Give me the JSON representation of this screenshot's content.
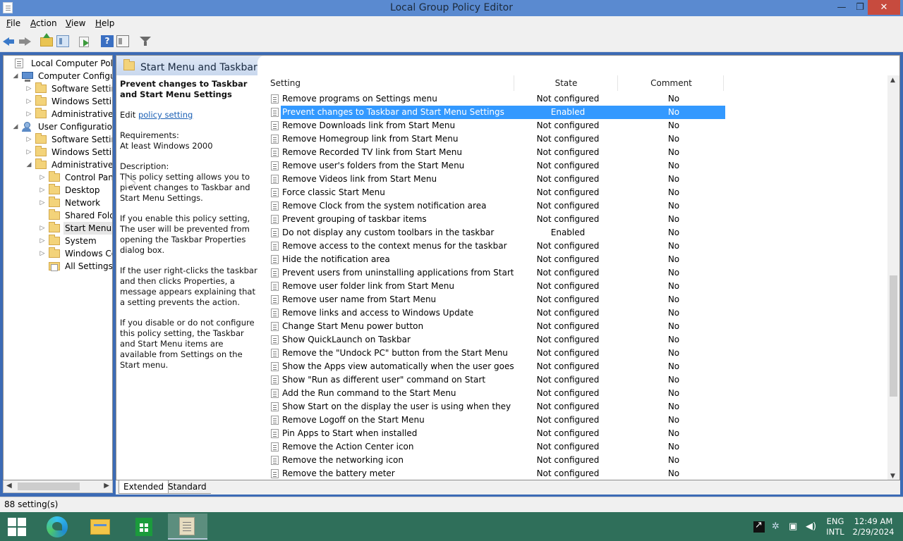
{
  "window": {
    "title": "Local Group Policy Editor",
    "controls": {
      "minimize": "—",
      "maximize": "❐",
      "close": "✕"
    }
  },
  "menubar": [
    {
      "label": "File",
      "accel": "F"
    },
    {
      "label": "Action",
      "accel": "A"
    },
    {
      "label": "View",
      "accel": "V"
    },
    {
      "label": "Help",
      "accel": "H"
    }
  ],
  "toolbar": {
    "icons": [
      "back-icon",
      "forward-icon",
      "up-folder-icon",
      "show-hide-tree-icon",
      "export-list-icon",
      "help-icon",
      "properties-icon",
      "filter-icon"
    ],
    "help_glyph": "?"
  },
  "tree": {
    "nodes": [
      {
        "label": "Local Computer Policy",
        "icon": "doc",
        "level": 0,
        "toggle": ""
      },
      {
        "label": "Computer Configura",
        "icon": "pc",
        "level": 1,
        "toggle": "◢"
      },
      {
        "label": "Software Settings",
        "icon": "folder",
        "level": 2,
        "toggle": "▷"
      },
      {
        "label": "Windows Setting",
        "icon": "folder",
        "level": 2,
        "toggle": "▷"
      },
      {
        "label": "Administrative Te",
        "icon": "folder",
        "level": 2,
        "toggle": "▷"
      },
      {
        "label": "User Configuration",
        "icon": "user",
        "level": 1,
        "toggle": "◢"
      },
      {
        "label": "Software Settings",
        "icon": "folder",
        "level": 2,
        "toggle": "▷"
      },
      {
        "label": "Windows Setting",
        "icon": "folder",
        "level": 2,
        "toggle": "▷"
      },
      {
        "label": "Administrative Te",
        "icon": "folder",
        "level": 2,
        "toggle": "◢"
      },
      {
        "label": "Control Panel",
        "icon": "folder",
        "level": 3,
        "toggle": "▷"
      },
      {
        "label": "Desktop",
        "icon": "folder",
        "level": 3,
        "toggle": "▷"
      },
      {
        "label": "Network",
        "icon": "folder",
        "level": 3,
        "toggle": "▷"
      },
      {
        "label": "Shared Folder",
        "icon": "folder",
        "level": 3,
        "toggle": ""
      },
      {
        "label": "Start Menu ar",
        "icon": "folder",
        "level": 3,
        "toggle": "▷",
        "selected": true
      },
      {
        "label": "System",
        "icon": "folder",
        "level": 3,
        "toggle": "▷"
      },
      {
        "label": "Windows Cor",
        "icon": "folder",
        "level": 3,
        "toggle": "▷"
      },
      {
        "label": "All Settings",
        "icon": "allset",
        "level": 3,
        "toggle": ""
      }
    ]
  },
  "right_pane": {
    "header_title": "Start Menu and Taskbar",
    "description": {
      "title": "Prevent changes to Taskbar and Start Menu Settings",
      "edit_prefix": "Edit ",
      "edit_link": "policy setting",
      "requirements_label": "Requirements:",
      "requirements_value": "At least Windows 2000",
      "description_label": "Description:",
      "p1": "This policy setting allows you to prevent changes to Taskbar and Start Menu Settings.",
      "p2": "If you enable this policy setting, The user will be prevented from opening the Taskbar Properties dialog box.",
      "p3": "If the user right-clicks the taskbar and then clicks Properties, a message appears explaining that a setting prevents the action.",
      "p4": "If you disable or do not configure this policy setting, the Taskbar and Start Menu items are available from Settings on the Start menu."
    },
    "columns": {
      "setting": "Setting",
      "state": "State",
      "comment": "Comment"
    },
    "rows": [
      {
        "name": "Remove programs on Settings menu",
        "state": "Not configured",
        "comment": "No"
      },
      {
        "name": "Prevent changes to Taskbar and Start Menu Settings",
        "state": "Enabled",
        "comment": "No",
        "selected": true
      },
      {
        "name": "Remove Downloads link from Start Menu",
        "state": "Not configured",
        "comment": "No"
      },
      {
        "name": "Remove Homegroup link from Start Menu",
        "state": "Not configured",
        "comment": "No"
      },
      {
        "name": "Remove Recorded TV link from Start Menu",
        "state": "Not configured",
        "comment": "No"
      },
      {
        "name": "Remove user's folders from the Start Menu",
        "state": "Not configured",
        "comment": "No"
      },
      {
        "name": "Remove Videos link from Start Menu",
        "state": "Not configured",
        "comment": "No"
      },
      {
        "name": "Force classic Start Menu",
        "state": "Not configured",
        "comment": "No"
      },
      {
        "name": "Remove Clock from the system notification area",
        "state": "Not configured",
        "comment": "No"
      },
      {
        "name": "Prevent grouping of taskbar items",
        "state": "Not configured",
        "comment": "No"
      },
      {
        "name": "Do not display any custom toolbars in the taskbar",
        "state": "Enabled",
        "comment": "No"
      },
      {
        "name": "Remove access to the context menus for the taskbar",
        "state": "Not configured",
        "comment": "No"
      },
      {
        "name": "Hide the notification area",
        "state": "Not configured",
        "comment": "No"
      },
      {
        "name": "Prevent users from uninstalling applications from Start",
        "state": "Not configured",
        "comment": "No"
      },
      {
        "name": "Remove user folder link from Start Menu",
        "state": "Not configured",
        "comment": "No"
      },
      {
        "name": "Remove user name from Start Menu",
        "state": "Not configured",
        "comment": "No"
      },
      {
        "name": "Remove links and access to Windows Update",
        "state": "Not configured",
        "comment": "No"
      },
      {
        "name": "Change Start Menu power button",
        "state": "Not configured",
        "comment": "No"
      },
      {
        "name": "Show QuickLaunch on Taskbar",
        "state": "Not configured",
        "comment": "No"
      },
      {
        "name": "Remove the \"Undock PC\" button from the Start Menu",
        "state": "Not configured",
        "comment": "No"
      },
      {
        "name": "Show the Apps view automatically when the user goes to St...",
        "state": "Not configured",
        "comment": "No"
      },
      {
        "name": "Show \"Run as different user\" command on Start",
        "state": "Not configured",
        "comment": "No"
      },
      {
        "name": "Add the Run command to the Start Menu",
        "state": "Not configured",
        "comment": "No"
      },
      {
        "name": "Show Start on the display the user is using when they press t...",
        "state": "Not configured",
        "comment": "No"
      },
      {
        "name": "Remove Logoff on the Start Menu",
        "state": "Not configured",
        "comment": "No"
      },
      {
        "name": "Pin Apps to Start when installed",
        "state": "Not configured",
        "comment": "No"
      },
      {
        "name": "Remove the Action Center icon",
        "state": "Not configured",
        "comment": "No"
      },
      {
        "name": "Remove the networking icon",
        "state": "Not configured",
        "comment": "No"
      },
      {
        "name": "Remove the battery meter",
        "state": "Not configured",
        "comment": "No"
      }
    ],
    "tabs": [
      "Extended",
      "Standard"
    ]
  },
  "statusbar": {
    "text": "88 setting(s)"
  },
  "taskbar": {
    "apps": [
      "start-button",
      "edge-icon",
      "file-explorer-icon",
      "store-icon",
      "group-policy-editor-icon"
    ],
    "tray": {
      "lang_1": "ENG",
      "lang_2": "INTL",
      "time": "12:49 AM",
      "date": "2/29/2024"
    }
  },
  "colors": {
    "titlebar": "#5a8ad0",
    "selection": "#3399ff",
    "taskbar": "#2f6f5a",
    "close": "#c74b3e"
  }
}
